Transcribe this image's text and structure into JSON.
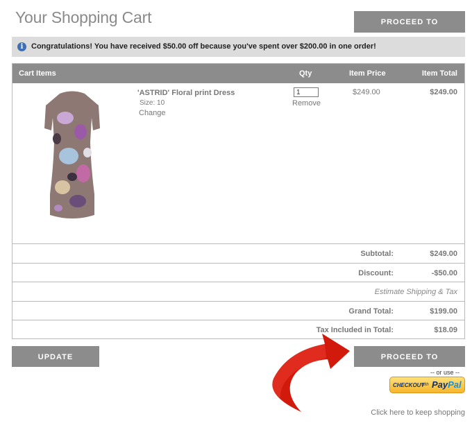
{
  "page": {
    "title": "Your Shopping Cart"
  },
  "buttons": {
    "checkout_top": "PROCEED TO CHECKOUT",
    "checkout_bottom": "PROCEED TO CHECKOUT",
    "update_quantity": "UPDATE QUANTITY"
  },
  "notice": {
    "icon": "info-icon",
    "text": "Congratulations! You have received $50.00 off because you've spent over $200.00 in one order!"
  },
  "cart": {
    "headers": {
      "items": "Cart Items",
      "qty": "Qty",
      "price": "Item Price",
      "total": "Item Total"
    },
    "items": [
      {
        "name": "'ASTRID' Floral print Dress",
        "size_label": "Size:  10",
        "change_link": "Change",
        "qty": "1",
        "remove_link": "Remove",
        "price": "$249.00",
        "total": "$249.00"
      }
    ]
  },
  "summary": {
    "subtotal_label": "Subtotal:",
    "subtotal_value": "$249.00",
    "discount_label": "Discount:",
    "discount_value": "-$50.00",
    "estimate_link": "Estimate Shipping & Tax",
    "grand_total_label": "Grand Total:",
    "grand_total_value": "$199.00",
    "tax_label": "Tax Included in Total:",
    "tax_value": "$18.09"
  },
  "alt_checkout": {
    "or_use": "-- or use --",
    "paypal_checkout": "CHECKOUT",
    "paypal_with": "with",
    "paypal_pay": "Pay",
    "paypal_pal": "Pal"
  },
  "links": {
    "keep_shopping": "Click here to keep shopping"
  },
  "colors": {
    "button_gray": "#8c8c8c",
    "notice_bg": "#dcdcdc",
    "arrow_red": "#d11a0c",
    "paypal_yellow": "#f6b62b",
    "paypal_blue": "#0f2f6f"
  }
}
